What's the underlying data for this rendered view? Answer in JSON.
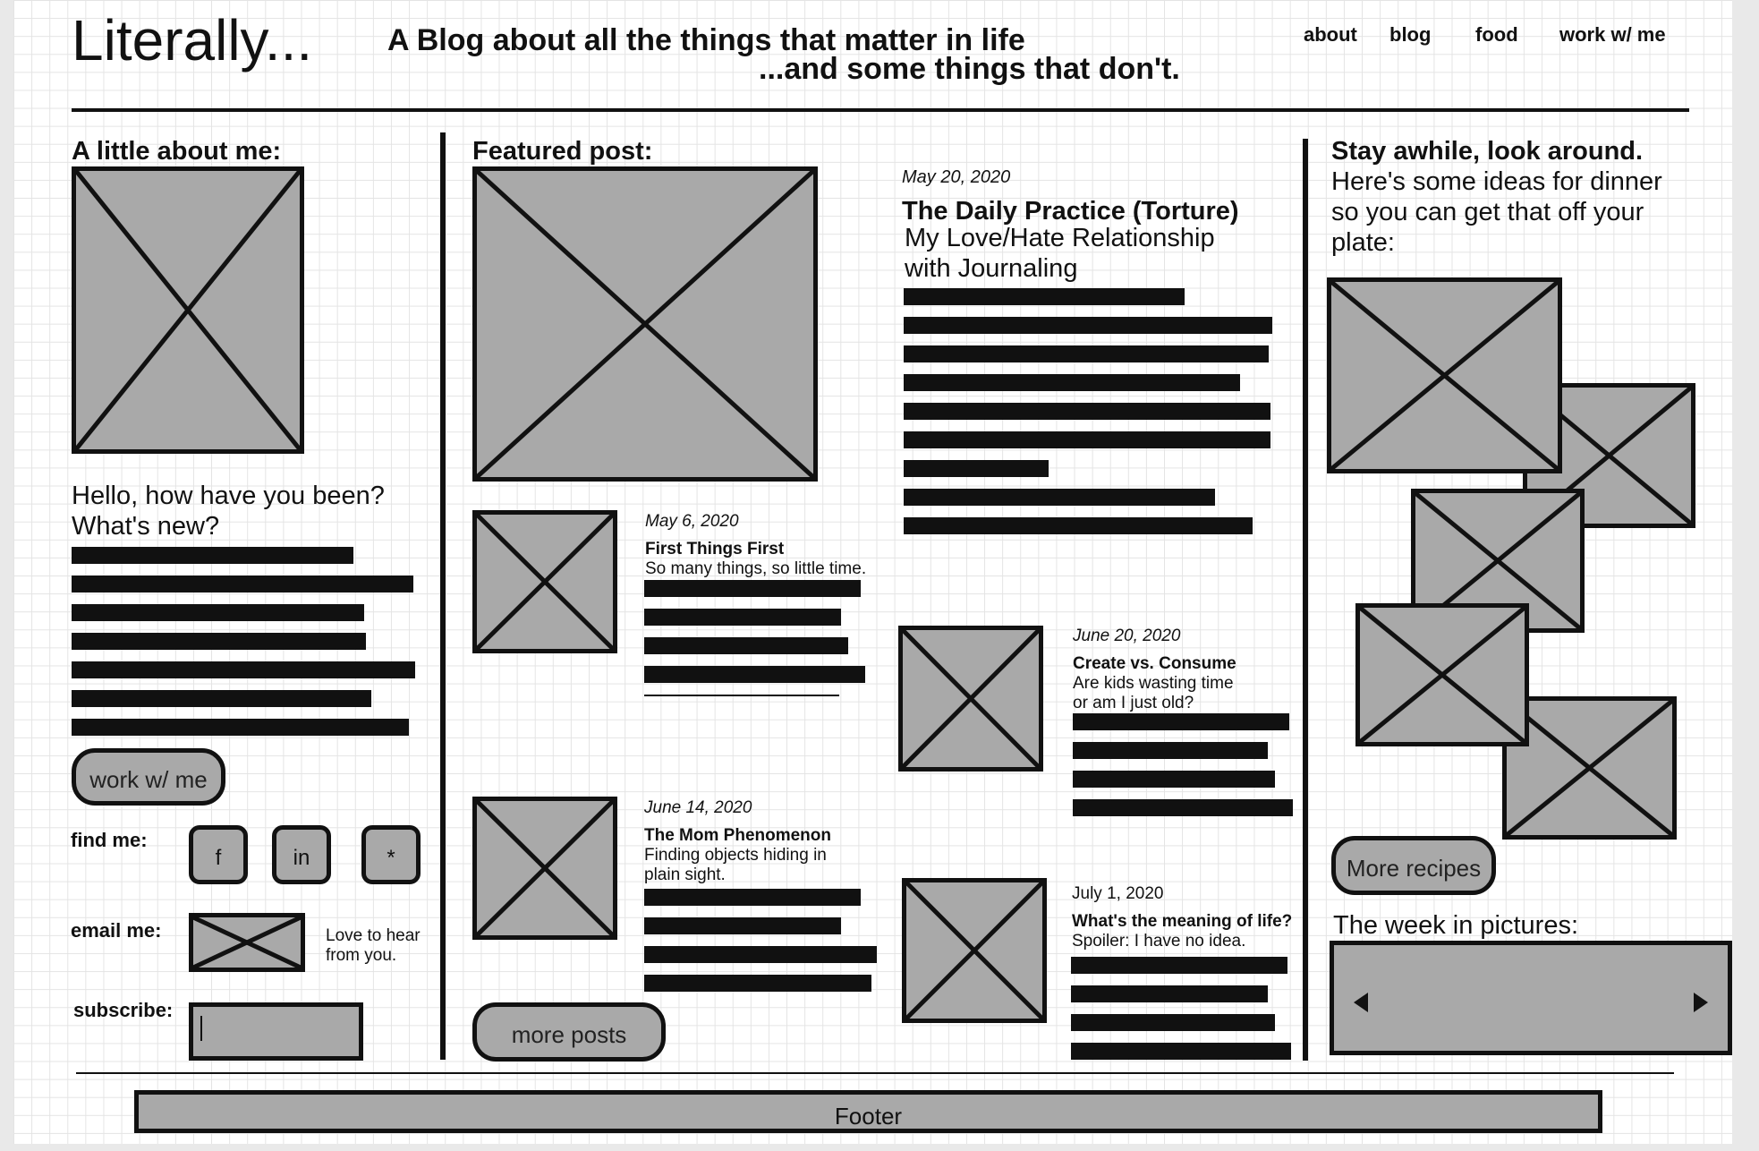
{
  "header": {
    "logo": "Literally...",
    "tagline_1": "A Blog about all the things that matter in life",
    "tagline_2": "...and some things that don't.",
    "nav": [
      "about",
      "blog",
      "food",
      "work w/ me"
    ]
  },
  "about": {
    "heading": "A little about me:",
    "greeting_1": "Hello, how have you been?",
    "greeting_2": "What's new?",
    "work_button": "work w/ me",
    "find_me_label": "find me:",
    "social": [
      "f",
      "in",
      "*"
    ],
    "email_label": "email me:",
    "email_note_1": "Love to hear",
    "email_note_2": "from you.",
    "subscribe_label": "subscribe:",
    "subscribe_value": ""
  },
  "featured": {
    "heading": "Featured post:",
    "date": "May 20, 2020",
    "title": "The Daily Practice (Torture)",
    "subtitle_1": "My Love/Hate Relationship",
    "subtitle_2": "with Journaling"
  },
  "posts": [
    {
      "date": "May 6, 2020",
      "title": "First Things First",
      "sub_1": "So many things, so little time.",
      "sub_2": ""
    },
    {
      "date": "June 14, 2020",
      "title": "The Mom Phenomenon",
      "sub_1": "Finding objects hiding in",
      "sub_2": "plain sight."
    },
    {
      "date": "June 20, 2020",
      "title": "Create vs. Consume",
      "sub_1": "Are kids wasting time",
      "sub_2": "or am I just old?"
    },
    {
      "date": "July 1, 2020",
      "title": "What's the meaning of life?",
      "sub_1": "Spoiler: I have no idea.",
      "sub_2": ""
    }
  ],
  "more_posts_button": "more posts",
  "recipes": {
    "heading": "Stay awhile, look around.",
    "text_1": "Here's some ideas for dinner",
    "text_2": "so you can get that off your",
    "text_3": "plate:",
    "button": "More recipes",
    "week_heading": "The week in pictures:"
  },
  "footer": {
    "label": "Footer"
  }
}
